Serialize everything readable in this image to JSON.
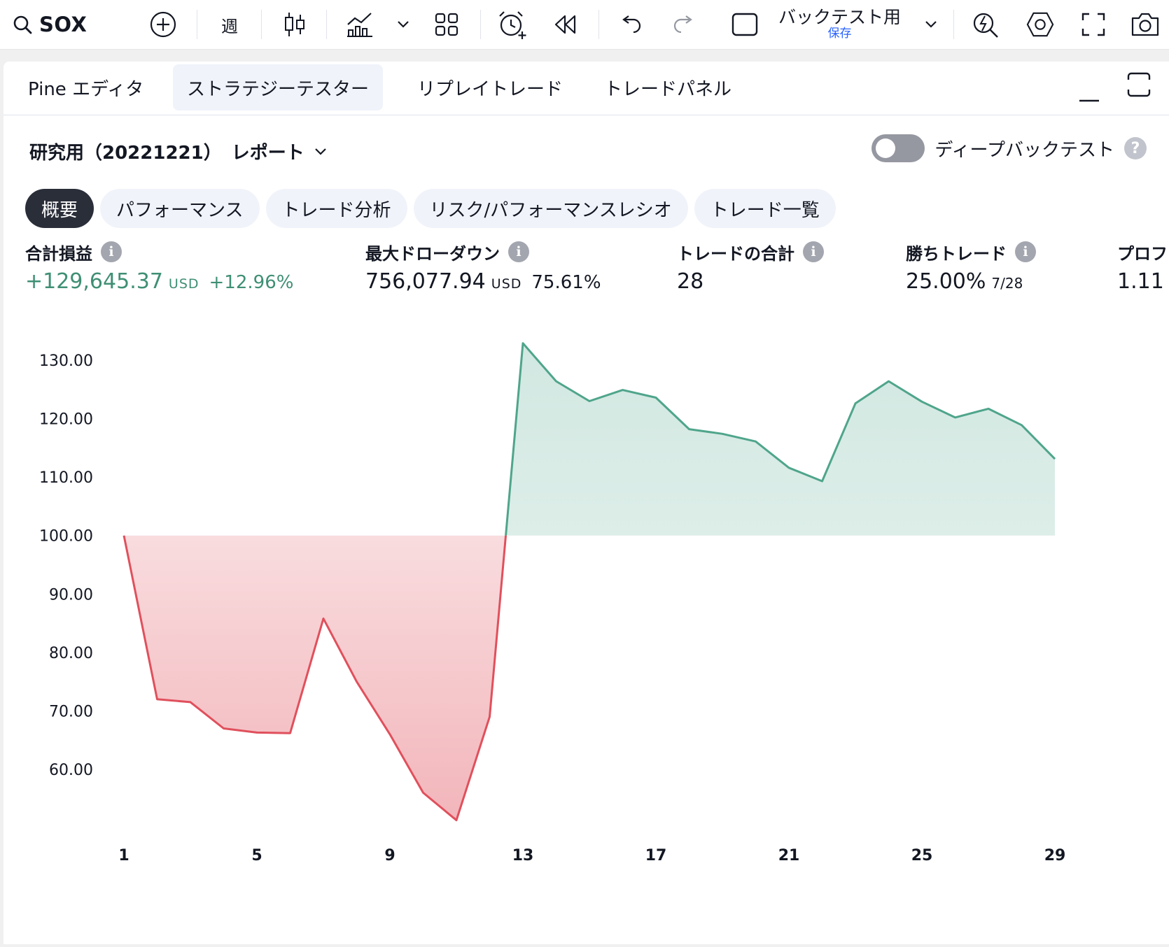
{
  "toolbar": {
    "symbol": "SOX",
    "interval": "週",
    "layout_name": "バックテスト用",
    "layout_status": "保存",
    "icons": [
      "search-icon",
      "add-circle-icon",
      "candlestick-icon",
      "indicators-icon",
      "chevron-down-icon",
      "layout-grid-icon",
      "alarm-add-icon",
      "replay-icon",
      "undo-icon",
      "redo-icon",
      "square-icon",
      "chevron-down-icon",
      "quick-search-icon",
      "settings-hex-icon",
      "fullscreen-icon",
      "camera-icon"
    ]
  },
  "tabs": [
    {
      "label": "Pine エディタ",
      "active": false
    },
    {
      "label": "ストラテジーテスター",
      "active": true
    },
    {
      "label": "リプレイトレード",
      "active": false
    },
    {
      "label": "トレードパネル",
      "active": false
    }
  ],
  "report": {
    "title": "研究用（20221221）",
    "report_label": "レポート",
    "deep_backtest_label": "ディープバックテスト",
    "deep_backtest_on": false,
    "help": "?"
  },
  "subtabs": [
    {
      "label": "概要",
      "active": true
    },
    {
      "label": "パフォーマンス",
      "active": false
    },
    {
      "label": "トレード分析",
      "active": false
    },
    {
      "label": "リスク/パフォーマンスレシオ",
      "active": false
    },
    {
      "label": "トレード一覧",
      "active": false
    }
  ],
  "metrics": {
    "net_profit": {
      "label": "合計損益",
      "value": "+129,645.37",
      "unit": "USD",
      "pct": "+12.96%"
    },
    "max_drawdown": {
      "label": "最大ドローダウン",
      "value": "756,077.94",
      "unit": "USD",
      "pct": "75.61%"
    },
    "total_trades": {
      "label": "トレードの合計",
      "value": "28"
    },
    "win_trades": {
      "label": "勝ちトレード",
      "value": "25.00%",
      "sub": "7/28"
    },
    "profit_factor": {
      "label": "プロフ",
      "value": "1.11"
    }
  },
  "colors": {
    "profit": "#4fa58b",
    "loss": "#e0505c",
    "accent": "#2962ff"
  },
  "chart_data": {
    "type": "area",
    "baseline": 100,
    "x": [
      1,
      2,
      3,
      4,
      5,
      6,
      7,
      8,
      9,
      10,
      11,
      12,
      13,
      14,
      15,
      16,
      17,
      18,
      19,
      20,
      21,
      22,
      23,
      24,
      25,
      26,
      27,
      28,
      29
    ],
    "values": [
      100,
      72,
      71.5,
      67,
      66.3,
      66.2,
      85.8,
      75,
      66,
      56,
      51.3,
      69,
      132.9,
      126.4,
      123,
      124.9,
      123.6,
      118.2,
      117.4,
      116.1,
      111.6,
      109.3,
      122.6,
      126.4,
      122.9,
      120.2,
      121.7,
      118.9,
      113.1
    ],
    "yticks": [
      "130.00",
      "120.00",
      "110.00",
      "100.00",
      "90.00",
      "80.00",
      "70.00",
      "60.00"
    ],
    "ytick_values": [
      130,
      120,
      110,
      100,
      90,
      80,
      70,
      60
    ],
    "xticks": [
      "1",
      "5",
      "9",
      "13",
      "17",
      "21",
      "25",
      "29"
    ],
    "xtick_values": [
      1,
      5,
      9,
      13,
      17,
      21,
      25,
      29
    ],
    "ylim": [
      50,
      134
    ]
  }
}
